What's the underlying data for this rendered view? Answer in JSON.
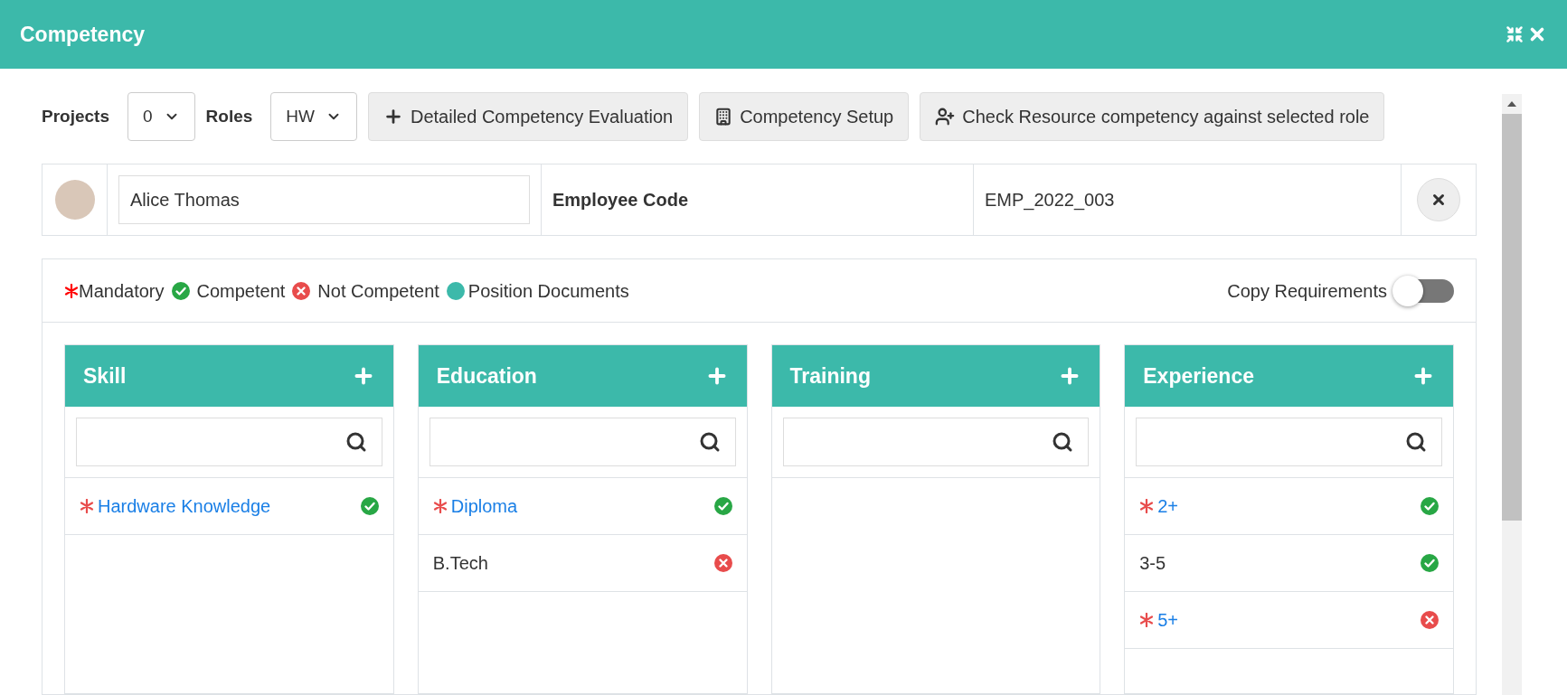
{
  "window": {
    "title": "Competency"
  },
  "toolbar": {
    "projects_label": "Projects",
    "projects_value": "0",
    "roles_label": "Roles",
    "roles_value": "HW",
    "buttons": [
      {
        "kind": "plus",
        "label": "Detailed Competency Evaluation"
      },
      {
        "kind": "building",
        "label": "Competency Setup"
      },
      {
        "kind": "user-plus",
        "label": "Check Resource competency against selected role"
      }
    ]
  },
  "employee": {
    "name": "Alice Thomas",
    "code_label": "Employee Code",
    "code": "EMP_2022_003"
  },
  "legend": {
    "mandatory": "Mandatory",
    "competent": "Competent",
    "not_competent": "Not Competent",
    "documents": "Position Documents"
  },
  "copy_requirements": {
    "label": "Copy Requirements",
    "on": false
  },
  "columns": [
    {
      "title": "Skill",
      "items": [
        {
          "label": "Hardware Knowledge",
          "mandatory": true,
          "competent": true
        }
      ]
    },
    {
      "title": "Education",
      "items": [
        {
          "label": "Diploma",
          "mandatory": true,
          "competent": true
        },
        {
          "label": "B.Tech",
          "mandatory": false,
          "competent": false
        }
      ]
    },
    {
      "title": "Training"
    },
    {
      "title": "Experience",
      "items": [
        {
          "label": "2+",
          "mandatory": true,
          "competent": true
        },
        {
          "label": "3-5",
          "mandatory": false,
          "competent": true
        },
        {
          "label": "5+",
          "mandatory": true,
          "competent": false
        }
      ]
    }
  ]
}
